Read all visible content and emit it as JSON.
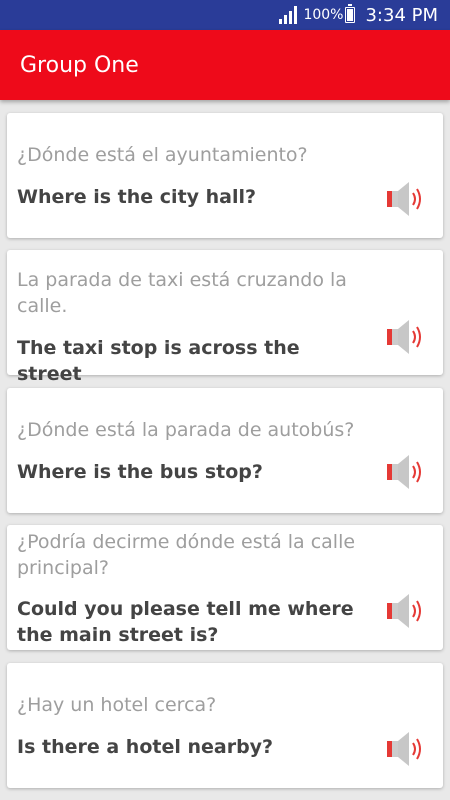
{
  "status_bar": {
    "battery": "100%",
    "time": "3:34 PM"
  },
  "app_bar": {
    "title": "Group One"
  },
  "cards": [
    {
      "spanish": "¿Dónde está el ayuntamiento?",
      "english": "Where is the city hall?"
    },
    {
      "spanish": "La parada de taxi está cruzando la calle.",
      "english": "The taxi stop is across the street"
    },
    {
      "spanish": "¿Dónde está la parada de autobús?",
      "english": "Where is the bus stop?"
    },
    {
      "spanish": "¿Podría decirme dónde está la calle principal?",
      "english": "Could you please tell me where the main street is?"
    },
    {
      "spanish": "¿Hay un hotel cerca?",
      "english": "Is there a hotel nearby?"
    }
  ],
  "icons": {
    "speaker": "speaker-icon"
  },
  "colors": {
    "status_bar": "#2a3c98",
    "app_bar": "#ee0a1a",
    "background": "#e9e9e9"
  }
}
